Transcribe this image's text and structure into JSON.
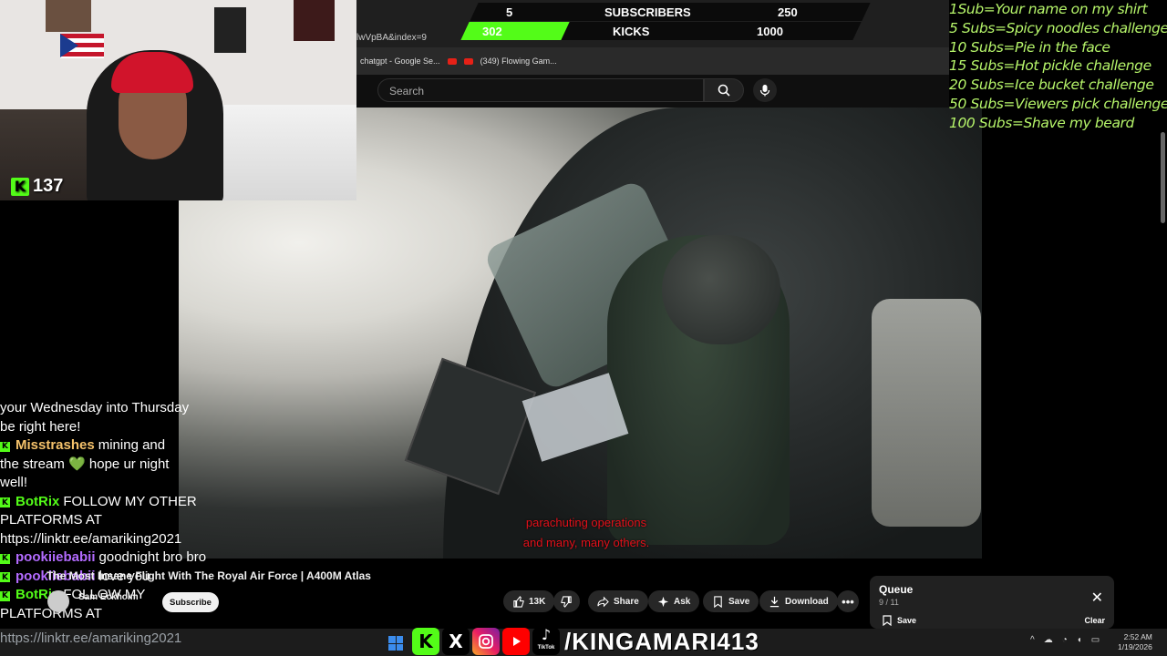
{
  "browser": {
    "url_fragment": "lwVpBA&index=9",
    "bookmarks": [
      "chatgpt - Google Se...",
      "(349) Flowing Gam..."
    ]
  },
  "youtube": {
    "search_placeholder": "Search",
    "video_title": "The Most Insane Flight With The Royal Air Force | A400M Atlas",
    "channel_name": "Sam Eckholm",
    "subscribe_label": "Subscribe",
    "subtitle_lines": [
      "parachuting operations",
      "and many, many others."
    ],
    "actions": {
      "like_count": "13K",
      "share": "Share",
      "ask": "Ask",
      "save": "Save",
      "download": "Download"
    },
    "queue": {
      "title": "Queue",
      "count": "9 / 11",
      "save": "Save",
      "clear": "Clear"
    }
  },
  "goal_bar": {
    "subs_current": "5",
    "subs_label": "SUBSCRIBERS",
    "subs_goal": "250",
    "kicks_current": "302",
    "kicks_label": "KICKS",
    "kicks_goal": "1000",
    "accent": "#53fc18"
  },
  "webcam": {
    "viewer_count": "137"
  },
  "goals_list": [
    "1Sub=Your name on my shirt",
    "5 Subs=Spicy noodles challenge",
    "10 Subs=Pie in the face",
    "15 Subs=Hot pickle challenge",
    "20 Subs=Ice bucket challenge",
    "50 Subs=Viewers pick challenge",
    "100 Subs=Shave my beard"
  ],
  "chat": {
    "lines": [
      {
        "text": "your Wednesday into Thursday"
      },
      {
        "text": "be right here!"
      },
      {
        "user": "Misstrashes",
        "user_color": "#f5c26b",
        "text": "mining and"
      },
      {
        "text": "the stream",
        "heart": "💚",
        "text2": "hope ur night"
      },
      {
        "text": "well!"
      },
      {
        "user": "BotRix",
        "user_color": "#53fc18",
        "text": "FOLLOW MY OTHER"
      },
      {
        "text": "PLATFORMS AT"
      },
      {
        "text": "https://linktr.ee/amariking2021"
      },
      {
        "user": "pookiiebabii",
        "user_color": "#b36bff",
        "text": "goodnight bro bro"
      },
      {
        "user": "pookiiebabii",
        "user_color": "#b36bff",
        "text": "love you"
      },
      {
        "user": "BotRix",
        "user_color": "#53fc18",
        "text": "FOLLOW MY"
      },
      {
        "text": "PLATFORMS AT"
      }
    ],
    "overflow": "https://linktr.ee/amariking2021"
  },
  "overlay": {
    "handle": "/KINGAMARI413",
    "tiktok_label": "TikTok"
  },
  "taskbar": {
    "time": "2:52 AM",
    "date": "1/19/2026"
  }
}
